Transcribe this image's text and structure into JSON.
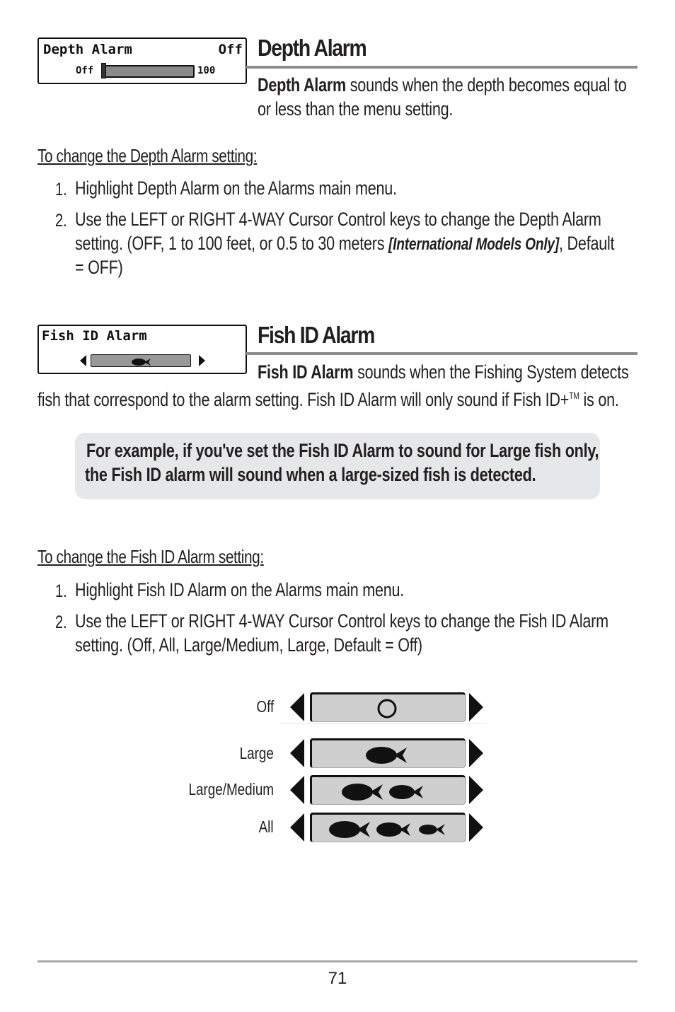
{
  "depth_alarm": {
    "lcd": {
      "title": "Depth Alarm",
      "value": "Off",
      "range_min": "Off",
      "range_max": "100",
      "slider_fraction": 0.0
    },
    "heading": "Depth Alarm",
    "intro_bold": "Depth Alarm",
    "intro_line1": " sounds when the depth becomes equal to",
    "intro_line2": "or less than the menu setting.",
    "subheading": "To change the Depth Alarm setting:",
    "steps": [
      {
        "num": "1.",
        "lines": [
          "Highlight Depth Alarm on the Alarms main menu."
        ]
      },
      {
        "num": "2.",
        "line1": "Use the LEFT or RIGHT 4-WAY Cursor Control keys to change the Depth Alarm",
        "line2_pre": "setting. (OFF, 1 to 100 feet, or 0.5 to 30 meters ",
        "line2_em": "[International Models Only]",
        "line2_post": ", Default",
        "line3": "= OFF)"
      }
    ]
  },
  "fish_id_alarm": {
    "lcd": {
      "title": "Fish ID Alarm",
      "icon": "fish-icon"
    },
    "heading": "Fish ID Alarm",
    "intro_bold": "Fish ID Alarm",
    "intro_line1": " sounds when the Fishing System detects",
    "intro_line2_pre": "fish that correspond to the alarm setting. Fish ID Alarm will only sound if Fish ID+",
    "intro_line2_sup": "TM",
    "intro_line2_post": " is on.",
    "note_line1": "For example, if you've set the Fish ID Alarm to sound for Large fish only,",
    "note_line2": "the Fish ID alarm will sound when a large-sized fish is detected.",
    "subheading": "To change the Fish ID Alarm setting:",
    "steps": [
      {
        "num": "1.",
        "line1": "Highlight Fish ID Alarm on the Alarms main menu."
      },
      {
        "num": "2.",
        "line1": "Use the LEFT or RIGHT 4-WAY Cursor Control keys to change the Fish ID Alarm",
        "line2": "setting. (Off, All, Large/Medium, Large, Default = Off)"
      }
    ],
    "options": [
      {
        "label": "Off",
        "icon": "circle-icon",
        "fish_count": 0
      },
      {
        "label": "Large",
        "icon": "fish-icon",
        "fish_count": 1
      },
      {
        "label": "Large/Medium",
        "icon": "fish-icon",
        "fish_count": 2
      },
      {
        "label": "All",
        "icon": "fish-icon",
        "fish_count": 3
      }
    ]
  },
  "footer": {
    "page_number": "71"
  }
}
